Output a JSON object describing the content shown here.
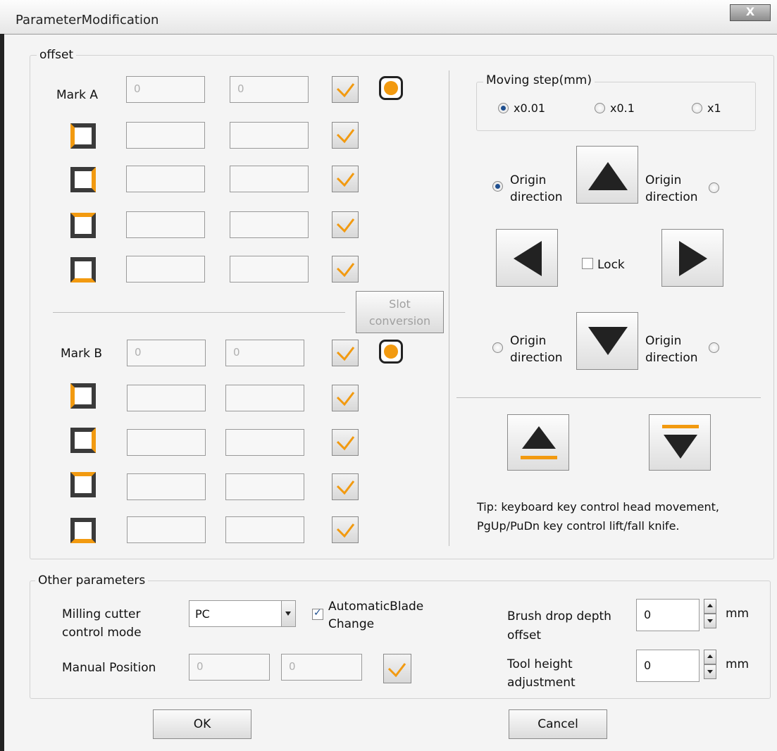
{
  "window": {
    "title": "ParameterModification",
    "close_label": "X"
  },
  "offset": {
    "group_label": "offset",
    "mark_a": {
      "label": "Mark A",
      "x_value": "0",
      "y_value": "0"
    },
    "mark_b": {
      "label": "Mark B",
      "x_value": "0",
      "y_value": "0"
    },
    "slot_conversion": {
      "label_line1": "Slot",
      "label_line2": "conversion"
    }
  },
  "moving_step": {
    "group_label": "Moving step(mm)",
    "options": [
      "x0.01",
      "x0.1",
      "x1"
    ],
    "selected": "x0.01"
  },
  "direction": {
    "top_left_line1": "Origin",
    "top_left_line2": "direction",
    "top_right_line1": "Origin",
    "top_right_line2": "direction",
    "bottom_left_line1": "Origin",
    "bottom_left_line2": "direction",
    "bottom_right_line1": "Origin",
    "bottom_right_line2": "direction",
    "lock_label": "Lock"
  },
  "tip": {
    "line1": "Tip: keyboard key control head movement,",
    "line2": "PgUp/PuDn key control lift/fall knife."
  },
  "other": {
    "group_label": "Other parameters",
    "milling_label_line1": "Milling cutter",
    "milling_label_line2": "control mode",
    "milling_mode_value": "PC",
    "auto_blade_line1": "AutomaticBlade",
    "auto_blade_line2": "Change",
    "manual_position_label": "Manual Position",
    "manual_x": "0",
    "manual_y": "0",
    "brush_label_line1": "Brush drop depth",
    "brush_label_line2": "offset",
    "brush_value": "0",
    "brush_unit": "mm",
    "tool_label_line1": "Tool height",
    "tool_label_line2": "adjustment",
    "tool_value": "0",
    "tool_unit": "mm"
  },
  "footer": {
    "ok_label": "OK",
    "cancel_label": "Cancel"
  },
  "colors": {
    "accent": "#f29a10",
    "frame": "#3a3a3a",
    "radio_selected": "#1f4f8f"
  }
}
